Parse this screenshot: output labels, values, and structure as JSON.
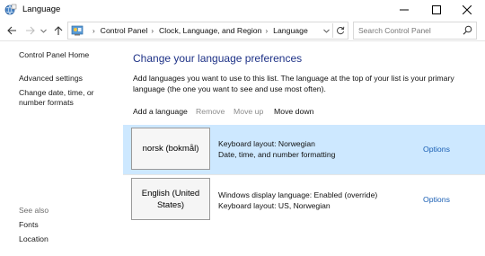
{
  "window": {
    "title": "Language",
    "icons": {
      "app": "language-globe-icon",
      "minimize": "minimize-icon",
      "maximize": "maximize-icon",
      "close": "close-icon"
    }
  },
  "nav": {
    "breadcrumbs": [
      "Control Panel",
      "Clock, Language, and Region",
      "Language"
    ],
    "search_placeholder": "Search Control Panel"
  },
  "sidebar": {
    "home": "Control Panel Home",
    "advanced": "Advanced settings",
    "date_formats": "Change date, time, or number formats",
    "see_also": "See also",
    "fonts": "Fonts",
    "location": "Location"
  },
  "main": {
    "title": "Change your language preferences",
    "description": "Add languages you want to use to this list. The language at the top of your list is your primary language (the one you want to see and use most often).",
    "toolbar": {
      "add": "Add a language",
      "remove": "Remove",
      "move_up": "Move up",
      "move_down": "Move down"
    },
    "languages": [
      {
        "name": "norsk (bokmål)",
        "line1": "Keyboard layout: Norwegian",
        "line2": "Date, time, and number formatting",
        "options": "Options",
        "selected": true
      },
      {
        "name": "English (United States)",
        "line1": "Windows display language: Enabled (override)",
        "line2": "Keyboard layout: US, Norwegian",
        "options": "Options",
        "selected": false
      }
    ]
  },
  "colors": {
    "title_blue": "#1e3287",
    "link_blue": "#1a5fb4",
    "selection": "#cde8ff",
    "disabled": "#8c8c8c"
  }
}
